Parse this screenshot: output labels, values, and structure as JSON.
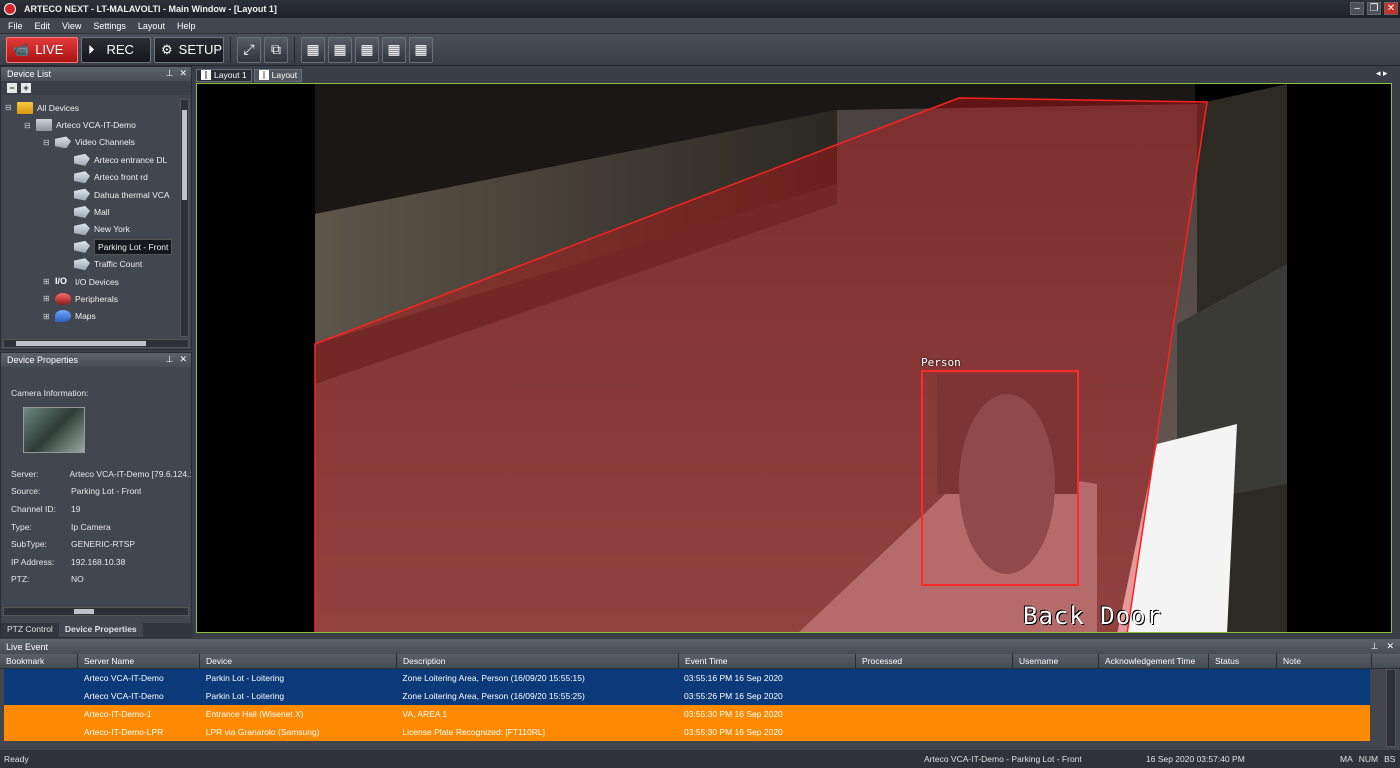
{
  "window": {
    "title": "ARTECO NEXT - LT-MALAVOLTI - Main Window - [Layout 1]"
  },
  "menu": [
    "File",
    "Edit",
    "View",
    "Settings",
    "Layout",
    "Help"
  ],
  "toolbar": {
    "live": "LIVE",
    "rec": "REC",
    "setup": "SETUP"
  },
  "device_list": {
    "title": "Device List",
    "tree": [
      {
        "label": "All Devices",
        "icon": "folder-icon",
        "level": 0,
        "toggle": "⊟"
      },
      {
        "label": "Arteco VCA-IT-Demo",
        "icon": "server-icon",
        "level": 1,
        "toggle": "⊟"
      },
      {
        "label": "Video Channels",
        "icon": "camera-group-icon",
        "level": 2,
        "toggle": "⊟"
      },
      {
        "label": "Arteco entrance DL",
        "icon": "camera-icon",
        "level": 3,
        "toggle": ""
      },
      {
        "label": "Arteco front rd",
        "icon": "camera-icon",
        "level": 3,
        "toggle": ""
      },
      {
        "label": "Dahua thermal VCA",
        "icon": "camera-icon",
        "level": 3,
        "toggle": ""
      },
      {
        "label": "Mall",
        "icon": "camera-icon",
        "level": 3,
        "toggle": ""
      },
      {
        "label": "New York",
        "icon": "camera-icon",
        "level": 3,
        "toggle": ""
      },
      {
        "label": "Parking Lot - Front",
        "icon": "camera-icon",
        "level": 3,
        "toggle": "",
        "selected": true
      },
      {
        "label": "Traffic Count",
        "icon": "camera-icon",
        "level": 3,
        "toggle": ""
      },
      {
        "label": "I/O Devices",
        "icon": "io-icon",
        "level": 2,
        "toggle": "⊞"
      },
      {
        "label": "Peripherals",
        "icon": "peripherals-icon",
        "level": 2,
        "toggle": "⊞"
      },
      {
        "label": "Maps",
        "icon": "map-icon",
        "level": 2,
        "toggle": "⊞"
      }
    ]
  },
  "device_properties": {
    "title": "Device Properties",
    "camera_info_label": "Camera Information:",
    "rows": [
      {
        "key": "Server:",
        "value": "Arteco VCA-IT-Demo [79.6.124.1"
      },
      {
        "key": "Source:",
        "value": "Parking Lot - Front"
      },
      {
        "key": "Channel ID:",
        "value": "19"
      },
      {
        "key": "Type:",
        "value": "Ip Camera"
      },
      {
        "key": "SubType:",
        "value": "GENERIC-RTSP"
      },
      {
        "key": "IP Address:",
        "value": "192.168.10.38"
      },
      {
        "key": "PTZ:",
        "value": "NO"
      }
    ],
    "tabs": [
      "PTZ Control",
      "Device Properties"
    ]
  },
  "view_tabs": [
    "Layout 1",
    "Layout"
  ],
  "viewer": {
    "detection_label": "Person",
    "overlay_text": "Back Door"
  },
  "live_event": {
    "title": "Live Event",
    "columns": [
      "Bookmark",
      "Server Name",
      "Device",
      "Description",
      "Event Time",
      "Processed",
      "Username",
      "Acknowledgement Time",
      "Status",
      "Note"
    ],
    "rows": [
      {
        "color": "blue",
        "cells": [
          "",
          "Arteco VCA-IT-Demo",
          "Parkin Lot - Loitering",
          "Zone Loitering Area,  Person (16/09/20 15:55:15)",
          "03:55:16 PM 16 Sep 2020",
          "",
          "",
          "",
          "",
          ""
        ]
      },
      {
        "color": "blue",
        "cells": [
          "",
          "Arteco VCA-IT-Demo",
          "Parkin Lot - Loitering",
          "Zone Loitering Area,  Person (16/09/20 15:55:25)",
          "03:55:26 PM 16 Sep 2020",
          "",
          "",
          "",
          "",
          ""
        ]
      },
      {
        "color": "orange",
        "cells": [
          "",
          "Arteco-IT-Demo-1",
          "Entrance Hall  (Wisenet X)",
          "VA, AREA 1",
          "03:55:30 PM 16 Sep 2020",
          "",
          "",
          "",
          "",
          ""
        ]
      },
      {
        "color": "orange",
        "cells": [
          "",
          "Arteco-IT-Demo-LPR",
          "LPR via Granarolo (Samsung)",
          "License Plate Recognized: [FT110RL]",
          "03:55:30 PM 16 Sep 2020",
          "",
          "",
          "",
          "",
          ""
        ]
      }
    ]
  },
  "status": {
    "ready": "Ready",
    "device": "Arteco VCA-IT-Demo - Parking Lot - Front",
    "time": "16 Sep 2020 03:57:40 PM",
    "indicators": [
      "MA",
      "NUM",
      "BS"
    ]
  },
  "colors": {
    "accent_live": "#d2232a",
    "event_blue": "#0b3a7a",
    "event_orange": "#ff8a00",
    "detection": "#ff2a2a",
    "viewer_border": "#8fbf3a"
  }
}
